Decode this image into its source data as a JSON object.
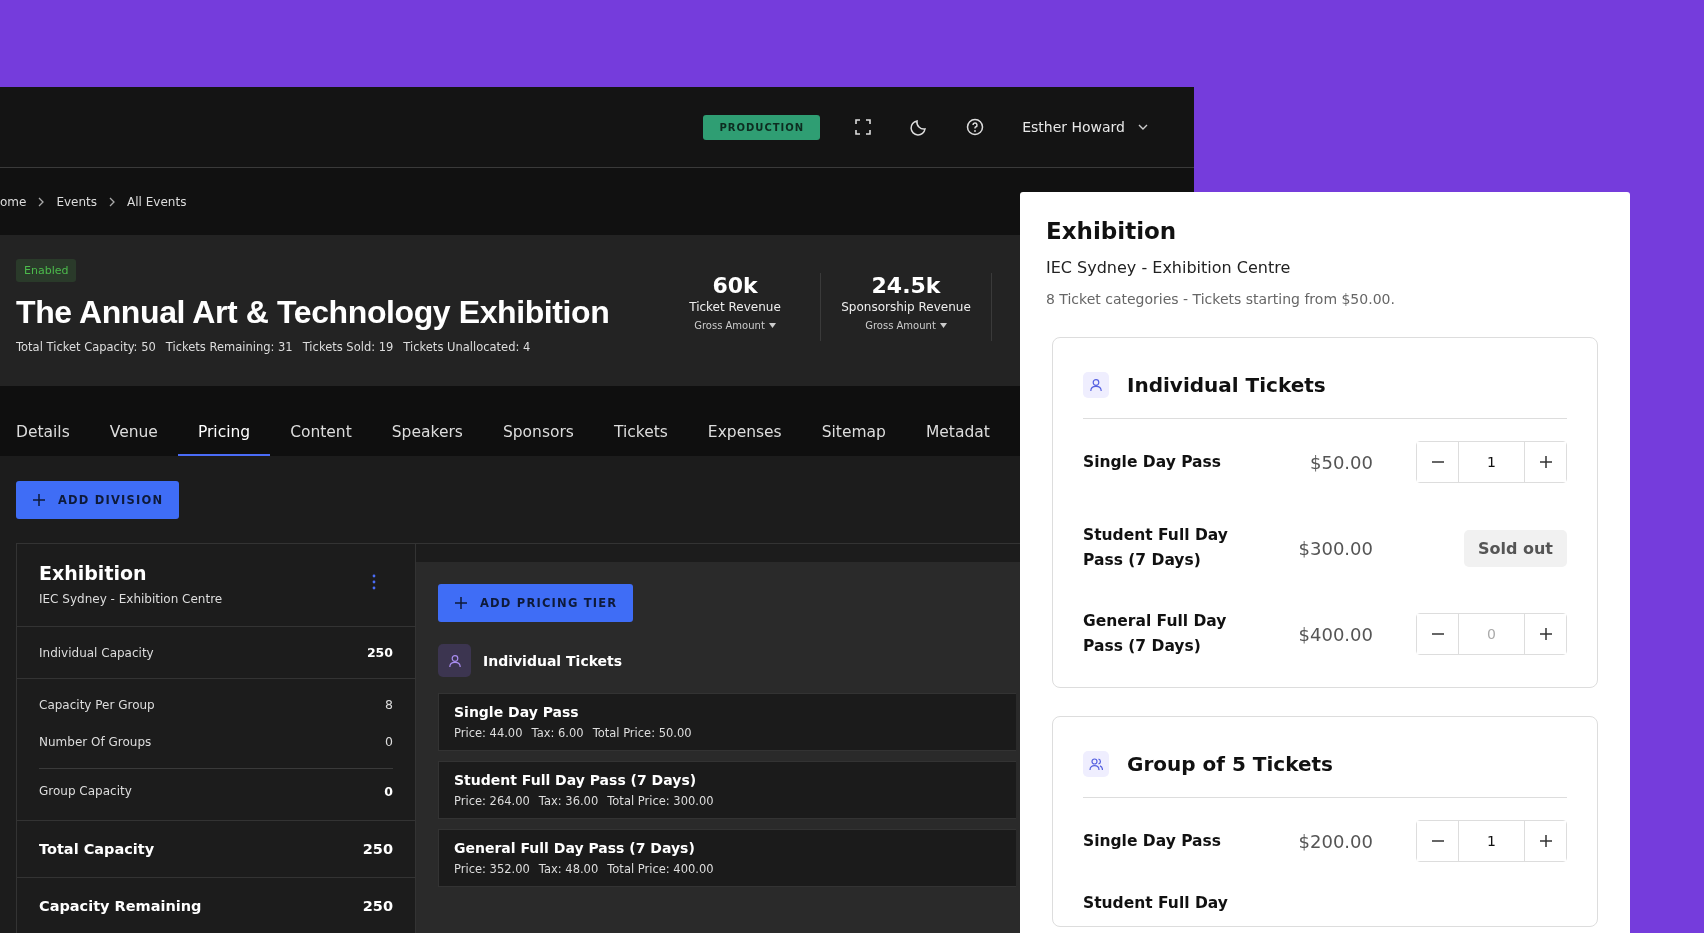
{
  "topbar": {
    "environment": "PRODUCTION",
    "user": "Esther Howard"
  },
  "breadcrumb": [
    "ome",
    "Events",
    "All Events"
  ],
  "event": {
    "status": "Enabled",
    "title": "The Annual Art & Technology Exhibition",
    "stats": [
      "Total Ticket Capacity: 50",
      "Tickets Remaining: 31",
      "Tickets Sold: 19",
      "Tickets Unallocated: 4"
    ],
    "revenue": [
      {
        "value": "60k",
        "label": "Ticket Revenue",
        "basis": "Gross Amount"
      },
      {
        "value": "24.5k",
        "label": "Sponsorship Revenue",
        "basis": "Gross Amount"
      }
    ]
  },
  "tabs": [
    {
      "label": "Details",
      "selected": false
    },
    {
      "label": "Venue",
      "selected": false
    },
    {
      "label": "Pricing",
      "selected": true
    },
    {
      "label": "Content",
      "selected": false
    },
    {
      "label": "Speakers",
      "selected": false
    },
    {
      "label": "Sponsors",
      "selected": false
    },
    {
      "label": "Tickets",
      "selected": false
    },
    {
      "label": "Expenses",
      "selected": false
    },
    {
      "label": "Sitemap",
      "selected": false
    },
    {
      "label": "Metadat",
      "selected": false
    }
  ],
  "add_division": "ADD DIVISION",
  "division": {
    "name": "Exhibition",
    "venue": "IEC Sydney - Exhibition Centre",
    "sections": [
      {
        "rows": [
          {
            "kind": "sum",
            "label": "Individual Capacity",
            "value": "250"
          }
        ]
      },
      {
        "rows": [
          {
            "kind": "detail",
            "label": "Capacity Per Group",
            "value": "8"
          },
          {
            "kind": "detail",
            "label": "Number Of Groups",
            "value": "0"
          },
          {
            "kind": "sum",
            "label": "Group Capacity",
            "value": "0"
          }
        ]
      },
      {
        "rows": [
          {
            "kind": "total",
            "label": "Total Capacity",
            "value": "250"
          }
        ]
      },
      {
        "rows": [
          {
            "kind": "total",
            "label": "Capacity Remaining",
            "value": "250"
          }
        ]
      }
    ]
  },
  "pricing": {
    "add_tier": "ADD PRICING TIER",
    "category": "Individual Tickets",
    "tiers": [
      {
        "name": "Single Day Pass",
        "details": [
          "Price: 44.00",
          "Tax: 6.00",
          "Total Price: 50.00"
        ]
      },
      {
        "name": "Student Full Day Pass (7 Days)",
        "details": [
          "Price: 264.00",
          "Tax: 36.00",
          "Total Price: 300.00"
        ]
      },
      {
        "name": "General Full Day Pass (7 Days)",
        "details": [
          "Price: 352.00",
          "Tax: 48.00",
          "Total Price: 400.00"
        ]
      }
    ]
  },
  "preview": {
    "title": "Exhibition",
    "venue": "IEC Sydney - Exhibition Centre",
    "summary": "8 Ticket categories - Tickets starting from $50.00.",
    "groups": [
      {
        "kind": "individual",
        "title": "Individual Tickets",
        "tickets": [
          {
            "name": "Single Day Pass",
            "price": "$50.00",
            "kind": "stepper",
            "value": "1"
          },
          {
            "name": "Student Full Day Pass (7 Days)",
            "price": "$300.00",
            "kind": "sold_out",
            "status": "Sold out"
          },
          {
            "name": "General Full Day Pass (7 Days)",
            "price": "$400.00",
            "kind": "stepper",
            "placeholder": "0"
          }
        ]
      },
      {
        "kind": "group",
        "title": "Group of 5 Tickets",
        "tickets": [
          {
            "name": "Single Day Pass",
            "price": "$200.00",
            "kind": "stepper",
            "value": "1"
          },
          {
            "name": "Student Full Day",
            "kind": "cut"
          }
        ]
      }
    ]
  }
}
